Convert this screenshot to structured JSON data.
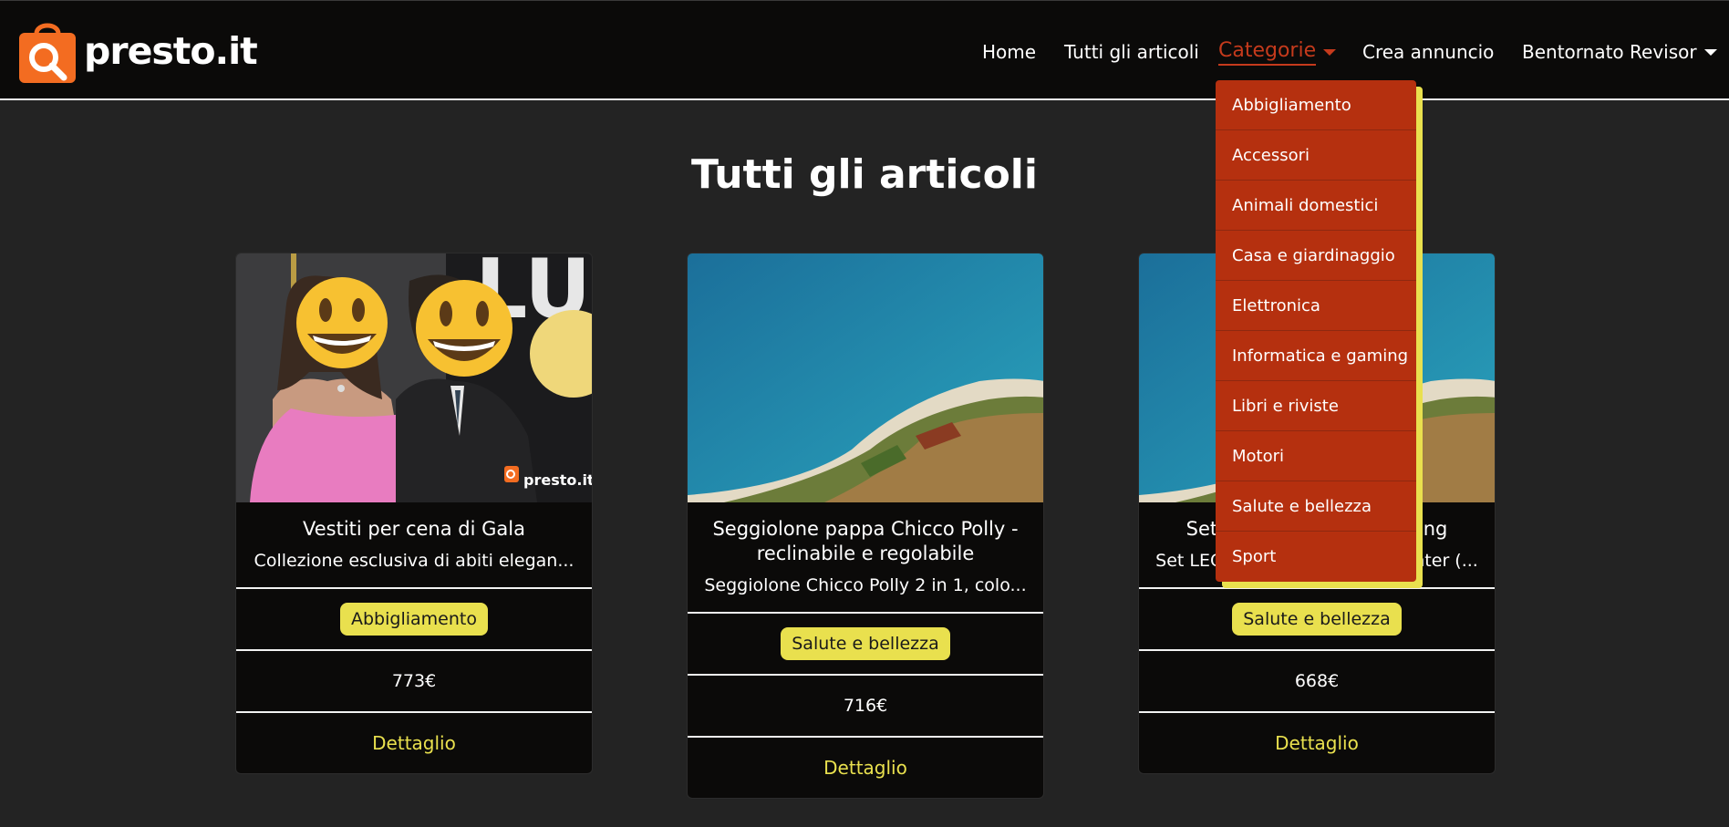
{
  "brand": {
    "name": "presto.it"
  },
  "nav": {
    "home": "Home",
    "tutti": "Tutti gli articoli",
    "categorie": "Categorie",
    "crea": "Crea annuncio",
    "user": "Bentornato Revisor"
  },
  "dropdown": {
    "items": [
      "Abbigliamento",
      "Accessori",
      "Animali domestici",
      "Casa e giardinaggio",
      "Elettronica",
      "Informatica e gaming",
      "Libri e riviste",
      "Motori",
      "Salute e bellezza",
      "Sport"
    ]
  },
  "page": {
    "title": "Tutti gli articoli"
  },
  "cards": [
    {
      "title": "Vestiti per cena di Gala",
      "description": "Collezione esclusiva di abiti elegan...",
      "category": "Abbigliamento",
      "price": "773€",
      "link": "Dettaglio",
      "watermark": "presto.it"
    },
    {
      "title": "Seggiolone pappa Chicco Polly - reclinabile e regolabile",
      "description": "Seggiolone Chicco Polly 2 in 1, colo...",
      "category": "Salute e bellezza",
      "price": "716€",
      "link": "Dettaglio"
    },
    {
      "title": "Set LEGO Star Wars X-Wing",
      "description": "Set LEGO originale X-Wing Fighter (...",
      "category": "Salute e bellezza",
      "price": "668€",
      "link": "Dettaglio"
    }
  ],
  "colors": {
    "accent_orange": "#c53a1c",
    "dropdown_bg": "#b5300f",
    "badge_yellow": "#e9e04e",
    "navbar_bg": "#0b0a09",
    "page_bg": "#232323"
  }
}
